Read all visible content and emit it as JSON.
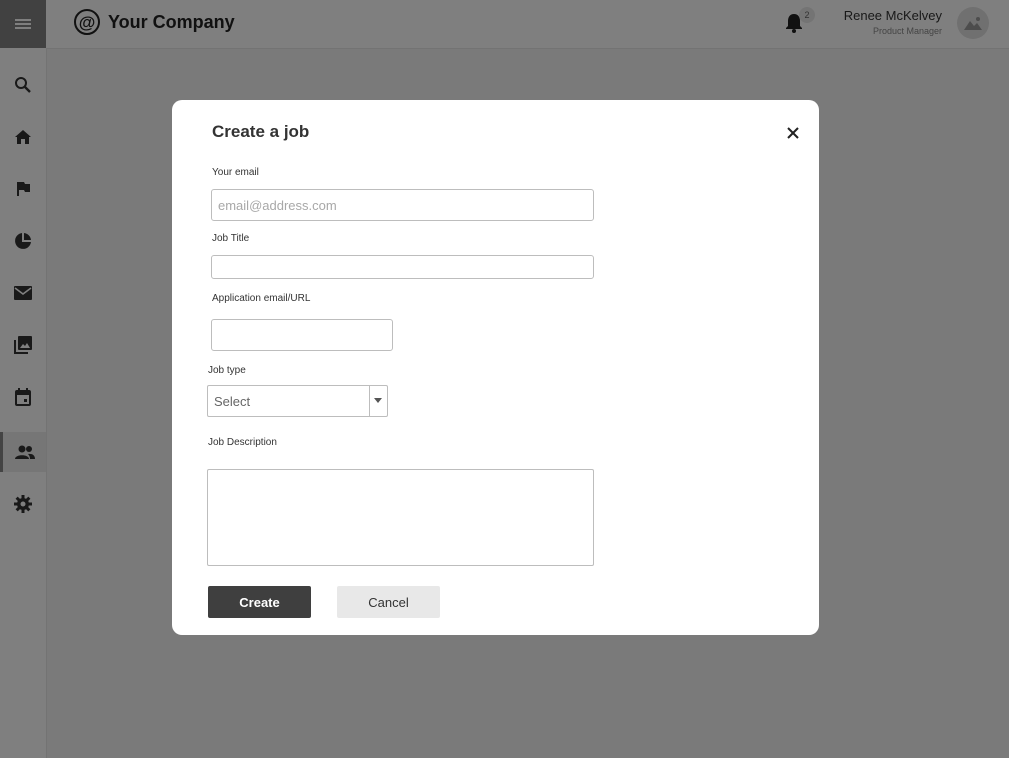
{
  "header": {
    "company_name": "Your Company",
    "notification_count": "2",
    "user_name": "Renee McKelvey",
    "user_role": "Product Manager"
  },
  "sidebar": {
    "items": [
      {
        "icon": "search-icon"
      },
      {
        "icon": "home-icon"
      },
      {
        "icon": "flag-icon"
      },
      {
        "icon": "pie-chart-icon"
      },
      {
        "icon": "mail-icon"
      },
      {
        "icon": "photo-library-icon"
      },
      {
        "icon": "calendar-icon"
      },
      {
        "icon": "people-icon",
        "active": true
      },
      {
        "icon": "gear-icon"
      }
    ]
  },
  "modal": {
    "title": "Create a job",
    "fields": {
      "email": {
        "label": "Your email",
        "placeholder": "email@address.com",
        "value": ""
      },
      "job_title": {
        "label": "Job Title",
        "value": ""
      },
      "application": {
        "label": "Application email/URL",
        "value": ""
      },
      "job_type": {
        "label": "Job type",
        "selected": "Select"
      },
      "description": {
        "label": "Job Description",
        "value": ""
      }
    },
    "buttons": {
      "create": "Create",
      "cancel": "Cancel"
    }
  },
  "colors": {
    "overlay": "#7f7f7f",
    "primary_button": "#3f3f3f",
    "secondary_button": "#e8e8e8"
  }
}
